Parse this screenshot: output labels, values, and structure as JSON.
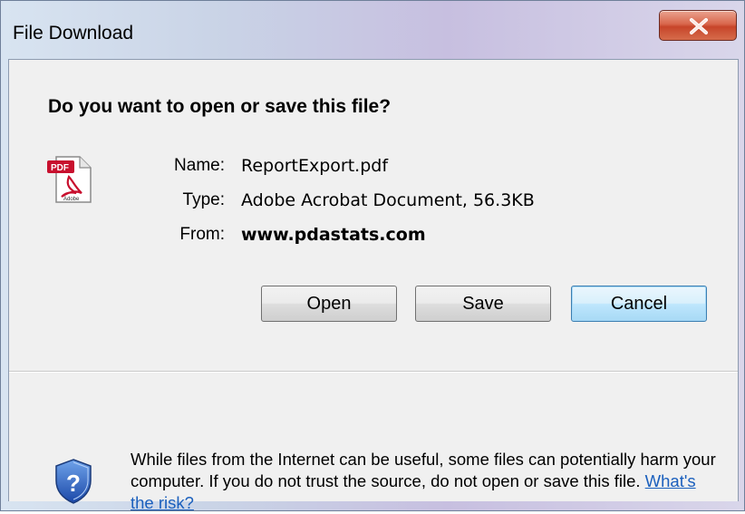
{
  "window": {
    "title": "File Download"
  },
  "titlebar": {
    "close_icon": "close-icon"
  },
  "dialog": {
    "question": "Do you want to open or save this file?",
    "file_icon": "pdf-file-icon",
    "file": {
      "name_label": "Name:",
      "name_value": "ReportExport.pdf",
      "type_label": "Type:",
      "type_value": "Adobe Acrobat Document, 56.3KB",
      "from_label": "From:",
      "from_value": "www.pdastats.com"
    },
    "buttons": {
      "open": "Open",
      "save": "Save",
      "cancel": "Cancel"
    },
    "warning": {
      "icon": "security-shield-question-icon",
      "text": "While files from the Internet can be useful, some files can potentially harm your computer. If you do not trust the source, do not open or save this file.",
      "link": "What's the risk?"
    }
  },
  "colors": {
    "link": "#1a5fbd",
    "close_button": "#c7452a",
    "default_button_border": "#3c7fb1"
  }
}
